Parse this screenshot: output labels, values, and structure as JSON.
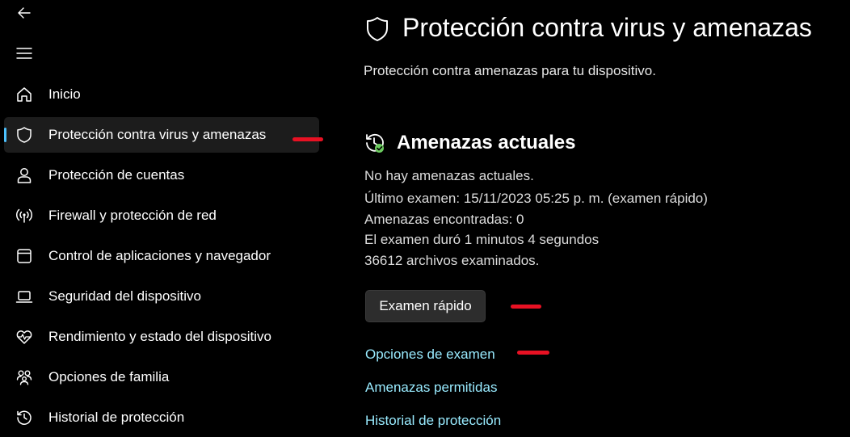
{
  "nav": {
    "back_label": "Atrás",
    "menu_label": "Menú",
    "items": [
      {
        "label": "Inicio",
        "icon": "home-icon"
      },
      {
        "label": "Protección contra virus y amenazas",
        "icon": "shield-icon",
        "selected": true
      },
      {
        "label": "Protección de cuentas",
        "icon": "person-icon"
      },
      {
        "label": "Firewall y protección de red",
        "icon": "wifi-icon"
      },
      {
        "label": "Control de aplicaciones y navegador",
        "icon": "browser-window-icon"
      },
      {
        "label": "Seguridad del dispositivo",
        "icon": "laptop-icon"
      },
      {
        "label": "Rendimiento y estado del dispositivo",
        "icon": "heart-pulse-icon"
      },
      {
        "label": "Opciones de familia",
        "icon": "family-icon"
      },
      {
        "label": "Historial de protección",
        "icon": "history-icon"
      }
    ]
  },
  "main": {
    "title": "Protección contra virus y amenazas",
    "subtitle": "Protección contra amenazas para tu dispositivo.",
    "section": {
      "title": "Amenazas actuales",
      "lines": [
        "No hay amenazas actuales.",
        "Último examen: 15/11/2023 05:25 p. m. (examen rápido)",
        "Amenazas encontradas: 0",
        "El examen duró 1 minutos 4 segundos",
        "36612 archivos examinados."
      ],
      "quick_scan_button": "Examen rápido",
      "links": [
        "Opciones de examen",
        "Amenazas permitidas",
        "Historial de protección"
      ]
    }
  },
  "colors": {
    "background": "#000000",
    "selected_item": "#1c1c1c",
    "accent_indicator": "#4cc2ff",
    "link": "#99ebff",
    "button": "#2d2d2d",
    "status_ok": "#6ccb5f",
    "annotation_mark": "#e81123"
  }
}
